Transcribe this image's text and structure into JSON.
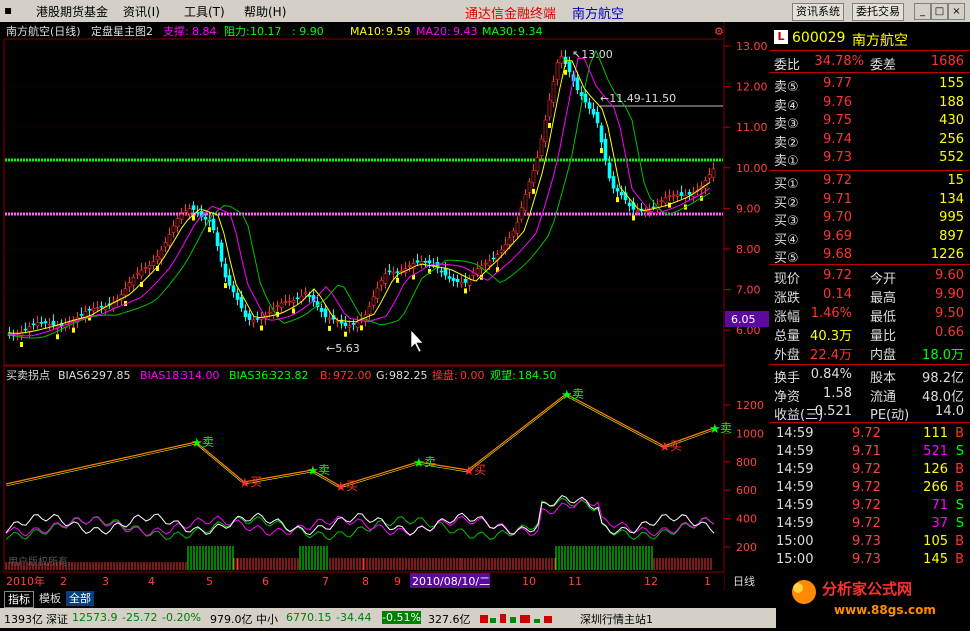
{
  "menu": [
    "港股期货基金",
    "资讯(I)",
    "工具(T)",
    "帮助(H)"
  ],
  "app_title": "通达信金融终端",
  "stock_title": "南方航空",
  "top_buttons": [
    "资讯系统",
    "委托交易"
  ],
  "window_buttons": [
    "_",
    "□",
    "×"
  ],
  "chart_header": {
    "name": "南方航空(日线)",
    "indicator": "定盘星主图2",
    "support_label": "支撑:",
    "support": "8.84",
    "resist_label": "阻力:",
    "resist": "10.17",
    "extra": ": 9.90",
    "ma10_label": "MA10:",
    "ma10": "9.59",
    "ma20_label": "MA20:",
    "ma20": "9.43",
    "ma30_label": "MA30:",
    "ma30": "9.34"
  },
  "price_annotations": {
    "high": "13.00",
    "low": "5.63",
    "range": "11.49-11.50",
    "cur_tag": "6.05"
  },
  "price_axis": [
    "13.00",
    "12.00",
    "11.00",
    "10.00",
    "9.00",
    "8.00",
    "7.00",
    "6.00"
  ],
  "lower_header": {
    "name": "买卖拐点",
    "bias6_label": "BIAS6:",
    "bias6": "297.85",
    "bias18_label": "BIAS18:",
    "bias18": "314.00",
    "bias36_label": "BIAS36:",
    "bias36": "323.82",
    "b_label": "B:",
    "b": "972.00",
    "g_label": "G:",
    "g": "982.25",
    "cp_label": "操盘:",
    "cp": "0.00",
    "gw_label": "观望:",
    "gw": "184.50"
  },
  "lower_axis": [
    "1200",
    "1000",
    "800",
    "600",
    "400",
    "200"
  ],
  "signals": {
    "sell": "卖",
    "buy": "买"
  },
  "date_axis": {
    "labels": [
      "2010年",
      "2",
      "3",
      "4",
      "5",
      "6",
      "7",
      "8",
      "9",
      "10",
      "11",
      "12",
      "1"
    ],
    "selected": "2010/08/10/二",
    "period": "日线"
  },
  "watermark": "用户版权所有",
  "quote": {
    "code": "600029",
    "name": "南方航空",
    "badge": "L",
    "weibi_label": "委比",
    "weibi": "34.78%",
    "weicha_label": "委差",
    "weicha": "1686",
    "asks": [
      {
        "label": "卖⑤",
        "price": "9.77",
        "vol": "155"
      },
      {
        "label": "卖④",
        "price": "9.76",
        "vol": "188"
      },
      {
        "label": "卖③",
        "price": "9.75",
        "vol": "430"
      },
      {
        "label": "卖②",
        "price": "9.74",
        "vol": "256"
      },
      {
        "label": "卖①",
        "price": "9.73",
        "vol": "552"
      }
    ],
    "bids": [
      {
        "label": "买①",
        "price": "9.72",
        "vol": "15"
      },
      {
        "label": "买②",
        "price": "9.71",
        "vol": "134"
      },
      {
        "label": "买③",
        "price": "9.70",
        "vol": "995"
      },
      {
        "label": "买④",
        "price": "9.69",
        "vol": "897"
      },
      {
        "label": "买⑤",
        "price": "9.68",
        "vol": "1226"
      }
    ],
    "stats": [
      {
        "l1": "现价",
        "v1": "9.72",
        "l2": "今开",
        "v2": "9.60"
      },
      {
        "l1": "涨跌",
        "v1": "0.14",
        "l2": "最高",
        "v2": "9.90"
      },
      {
        "l1": "涨幅",
        "v1": "1.46%",
        "l2": "最低",
        "v2": "9.50"
      },
      {
        "l1": "总量",
        "v1": "40.3万",
        "l2": "量比",
        "v2": "0.66"
      },
      {
        "l1": "外盘",
        "v1": "22.4万",
        "l2": "内盘",
        "v2": "18.0万"
      }
    ],
    "fin": [
      {
        "l1": "换手",
        "v1": "0.84%",
        "l2": "股本",
        "v2": "98.2亿"
      },
      {
        "l1": "净资",
        "v1": "1.58",
        "l2": "流通",
        "v2": "48.0亿"
      },
      {
        "l1": "收益(三)",
        "v1": "0.521",
        "l2": "PE(动)",
        "v2": "14.0"
      }
    ],
    "trades": [
      {
        "t": "14:59",
        "p": "9.72",
        "v": "111",
        "bs": "B"
      },
      {
        "t": "14:59",
        "p": "9.71",
        "v": "521",
        "bs": "S"
      },
      {
        "t": "14:59",
        "p": "9.72",
        "v": "126",
        "bs": "B"
      },
      {
        "t": "14:59",
        "p": "9.72",
        "v": "266",
        "bs": "B"
      },
      {
        "t": "14:59",
        "p": "9.72",
        "v": "71",
        "bs": "S"
      },
      {
        "t": "14:59",
        "p": "9.72",
        "v": "37",
        "bs": "S"
      },
      {
        "t": "15:00",
        "p": "9.73",
        "v": "105",
        "bs": "B"
      },
      {
        "t": "15:00",
        "p": "9.73",
        "v": "145",
        "bs": "B"
      }
    ]
  },
  "bottom_tabs": [
    "指标",
    "模板",
    "全部"
  ],
  "status": {
    "s1": "1393亿",
    "s2_label": "深证",
    "s2": "12573.9",
    "s2_chg": "-25.72",
    "s2_pct": "-0.20%",
    "s2_amt": "979.0亿",
    "s3_label": "中小",
    "s3": "6770.15",
    "s3_chg": "-34.44",
    "s3_pct": "-0.51%",
    "s3_amt": "327.6亿",
    "s4": "深圳行情主站1"
  },
  "logo": {
    "text": "分析家公式网",
    "url": "www.88gs.com"
  },
  "colors": {
    "up": "#ff3232",
    "down": "#00ffff",
    "ma10": "#ffff00",
    "ma20": "#ff00ff",
    "ma30": "#00c000",
    "grid": "#800000"
  }
}
